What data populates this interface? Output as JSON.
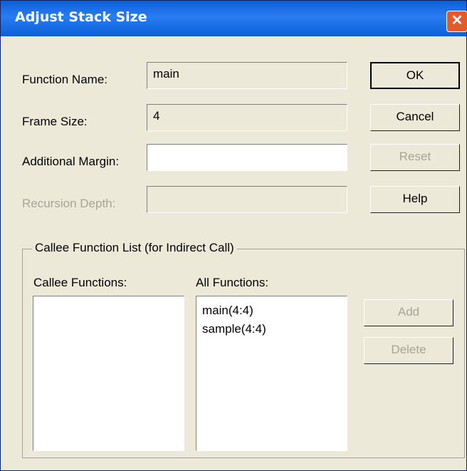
{
  "window": {
    "title": "Adjust Stack Size"
  },
  "labels": {
    "function_name": "Function Name:",
    "frame_size": "Frame Size:",
    "additional_margin": "Additional Margin:",
    "recursion_depth": "Recursion Depth:"
  },
  "fields": {
    "function_name": "main",
    "frame_size": "4",
    "additional_margin": "",
    "recursion_depth": ""
  },
  "buttons": {
    "ok": "OK",
    "cancel": "Cancel",
    "reset": "Reset",
    "help": "Help",
    "add": "Add",
    "delete": "Delete"
  },
  "group": {
    "label": "Callee Function List (for Indirect Call)",
    "callee_label": "Callee Functions:",
    "all_label": "All Functions:",
    "all_functions": [
      "main(4:4)",
      "sample(4:4)"
    ]
  }
}
